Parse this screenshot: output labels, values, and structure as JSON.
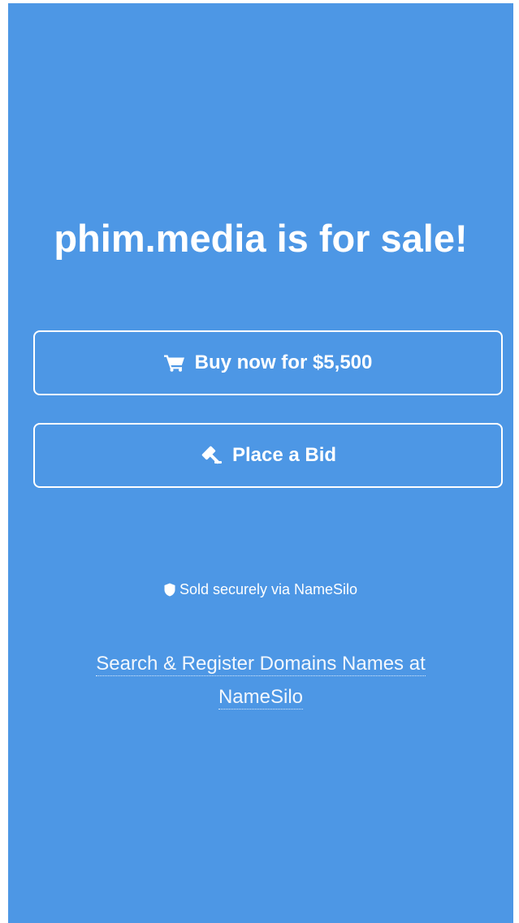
{
  "page": {
    "heading": "phim.media is for sale!",
    "background_color": "#4d97e5"
  },
  "buy_button": {
    "label": "Buy now for $5,500",
    "icon": "cart-icon"
  },
  "bid_button": {
    "label": "Place a Bid",
    "icon": "gavel-icon"
  },
  "secure_note": {
    "text": "Sold securely via NameSilo",
    "icon": "shield-icon"
  },
  "footer_link": {
    "text": "Search & Register Domains Names at NameSilo"
  }
}
